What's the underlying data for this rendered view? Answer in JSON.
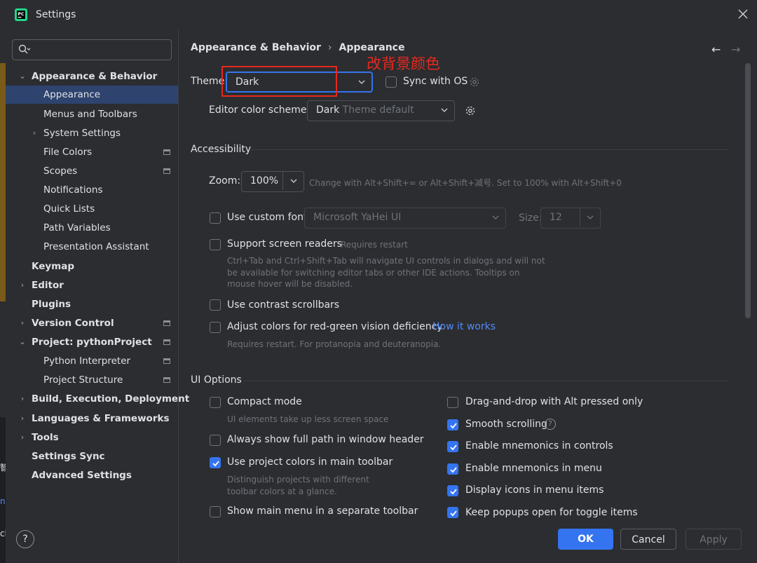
{
  "window": {
    "title": "Settings"
  },
  "edge_fragments": [
    "智",
    "ns",
    "ch"
  ],
  "sidebar": {
    "search_placeholder": "",
    "items": [
      {
        "label": "Appearance & Behavior",
        "expanded": true
      },
      {
        "label": "Appearance",
        "selected": true
      },
      {
        "label": "Menus and Toolbars"
      },
      {
        "label": "System Settings",
        "collapsed": true
      },
      {
        "label": "File Colors",
        "icon": "project-icon"
      },
      {
        "label": "Scopes",
        "icon": "project-icon"
      },
      {
        "label": "Notifications"
      },
      {
        "label": "Quick Lists"
      },
      {
        "label": "Path Variables"
      },
      {
        "label": "Presentation Assistant"
      },
      {
        "label": "Keymap"
      },
      {
        "label": "Editor",
        "collapsed": true
      },
      {
        "label": "Plugins"
      },
      {
        "label": "Version Control",
        "collapsed": true,
        "icon": "project-icon"
      },
      {
        "label": "Project: pythonProject",
        "expanded": true,
        "icon": "project-icon"
      },
      {
        "label": "Python Interpreter",
        "icon": "project-icon"
      },
      {
        "label": "Project Structure",
        "icon": "project-icon"
      },
      {
        "label": "Build, Execution, Deployment",
        "collapsed": true
      },
      {
        "label": "Languages & Frameworks",
        "collapsed": true
      },
      {
        "label": "Tools",
        "collapsed": true
      },
      {
        "label": "Settings Sync"
      },
      {
        "label": "Advanced Settings"
      }
    ],
    "help_label": "?"
  },
  "breadcrumb": {
    "parent": "Appearance & Behavior",
    "sep": "›",
    "current": "Appearance"
  },
  "nav": {
    "back": "←",
    "forward": "→"
  },
  "theme": {
    "label": "Theme:",
    "value": "Dark",
    "sync_label": "Sync with OS",
    "sync_checked": false
  },
  "annotation": "改背景颜色",
  "editor_scheme": {
    "label": "Editor color scheme:",
    "value_main": "Dark",
    "value_dim": " Theme default"
  },
  "accessibility": {
    "title": "Accessibility",
    "zoom_label": "Zoom:",
    "zoom_value": "100%",
    "zoom_hint": "Change with Alt+Shift+= or Alt+Shift+减号. Set to 100% with Alt+Shift+0",
    "custom_font_label": "Use custom font:",
    "custom_font_checked": false,
    "font_value": "Microsoft YaHei UI",
    "size_label": "Size:",
    "size_value": "12",
    "screen_readers_label": "Support screen readers",
    "screen_readers_checked": false,
    "screen_readers_restart": "Requires restart",
    "screen_readers_desc": "Ctrl+Tab and Ctrl+Shift+Tab will navigate UI controls in dialogs and will not be available for switching editor tabs or other IDE actions. Tooltips on mouse hover will be disabled.",
    "contrast_label": "Use contrast scrollbars",
    "contrast_checked": false,
    "redgreen_label": "Adjust colors for red-green vision deficiency",
    "redgreen_checked": false,
    "how_link": "How it works",
    "redgreen_hint": "Requires restart. For protanopia and deuteranopia."
  },
  "ui_options": {
    "title": "UI Options",
    "compact_label": "Compact mode",
    "compact_checked": false,
    "compact_hint": "UI elements take up less screen space",
    "fullpath_label": "Always show full path in window header",
    "fullpath_checked": false,
    "projcolors_label": "Use project colors in main toolbar",
    "projcolors_checked": true,
    "projcolors_hint": "Distinguish projects with different toolbar colors at a glance.",
    "mainmenu_label": "Show main menu in a separate toolbar",
    "mainmenu_checked": false,
    "dragdrop_label": "Drag-and-drop with Alt pressed only",
    "dragdrop_checked": false,
    "smooth_label": "Smooth scrolling",
    "smooth_checked": true,
    "smooth_help": "?",
    "mnem_controls_label": "Enable mnemonics in controls",
    "mnem_controls_checked": true,
    "mnem_menu_label": "Enable mnemonics in menu",
    "mnem_menu_checked": true,
    "icons_label": "Display icons in menu items",
    "icons_checked": true,
    "popups_label": "Keep popups open for toggle items",
    "popups_checked": true
  },
  "buttons": {
    "ok": "OK",
    "cancel": "Cancel",
    "apply": "Apply"
  },
  "colors": {
    "accent": "#3574f0",
    "background": "#2b2d30",
    "selection": "#2e436e",
    "annotation": "#e8281d",
    "link": "#548af7"
  }
}
